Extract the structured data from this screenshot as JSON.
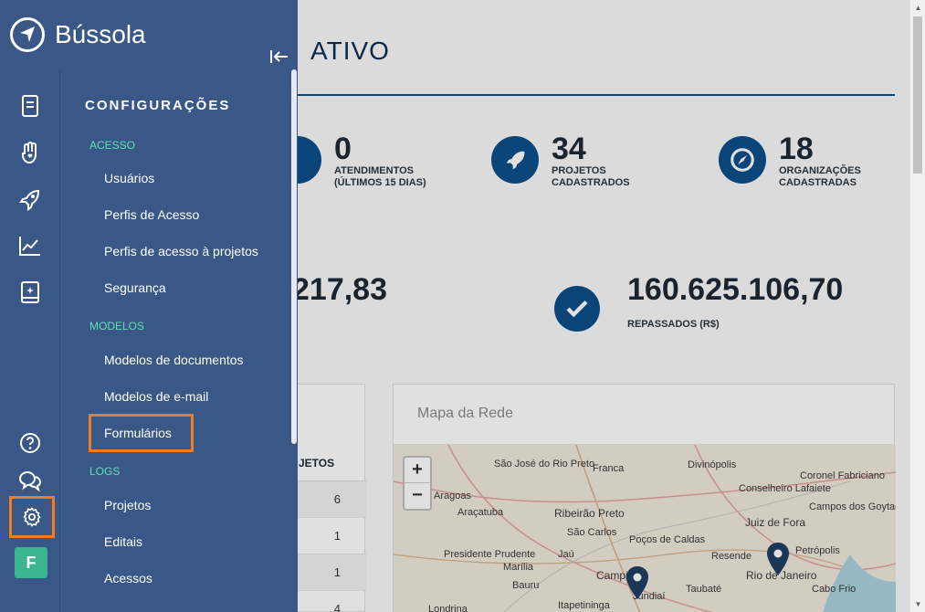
{
  "app": {
    "name": "Bússola"
  },
  "main": {
    "title_partial": "ATIVO",
    "stats": [
      {
        "value": "0",
        "caption": "ATENDIMENTOS (ÚLTIMOS 15 DIAS)",
        "icon": "user-icon"
      },
      {
        "value": "34",
        "caption": "PROJETOS CADASTRADOS",
        "icon": "rocket-icon"
      },
      {
        "value": "18",
        "caption": "ORGANIZAÇÕES CADASTRADAS",
        "icon": "compass-icon"
      }
    ],
    "amount_partial": "217,83",
    "repassados": {
      "value": "160.625.106,70",
      "caption": "REPASSADOS (R$)"
    },
    "table": {
      "header_partial": "JETOS",
      "rows": [
        "6",
        "1",
        "1",
        "4"
      ]
    },
    "map": {
      "title": "Mapa da Rede",
      "zoom_in": "+",
      "zoom_out": "−",
      "cities": [
        "São José do Rio Preto",
        "Franca",
        "Divinópolis",
        "Conselheiro Lafaiete",
        "Coronel Fabriciano",
        "Campos dos Goytacazes",
        "Juiz de Fora",
        "Ribeirão Preto",
        "São Carlos",
        "Araçatuba",
        "Poços de Caldas",
        "Presidente Prudente",
        "Resende",
        "Rio de Janeiro",
        "Cabo Frio",
        "Campinas",
        "Jundiaí",
        "Taubaté",
        "Londrina",
        "Itapetininga",
        "Marília",
        "Jaú",
        "Bauru",
        "Petrópolis",
        "Aragoas"
      ]
    }
  },
  "sidebar": {
    "title": "CONFIGURAÇÕES",
    "sections": [
      {
        "label": "ACESSO",
        "items": [
          "Usuários",
          "Perfis de Acesso",
          "Perfis de acesso à projetos",
          "Segurança"
        ]
      },
      {
        "label": "MODELOS",
        "items": [
          "Modelos de documentos",
          "Modelos de e-mail",
          "Formulários"
        ]
      },
      {
        "label": "LOGS",
        "items": [
          "Projetos",
          "Editais",
          "Acessos"
        ]
      }
    ],
    "rail_icons": [
      "document-icon",
      "hand-heart-icon",
      "rocket-icon",
      "chart-line-icon",
      "book-sparkle-icon",
      "help-icon",
      "chat-icon",
      "gear-icon"
    ],
    "avatar_initial": "F"
  },
  "colors": {
    "sidebar": "#3a5887",
    "accent": "#5ee0b0",
    "highlight": "#f47b20",
    "primary": "#0b4f8a",
    "avatar": "#3bb58f"
  }
}
